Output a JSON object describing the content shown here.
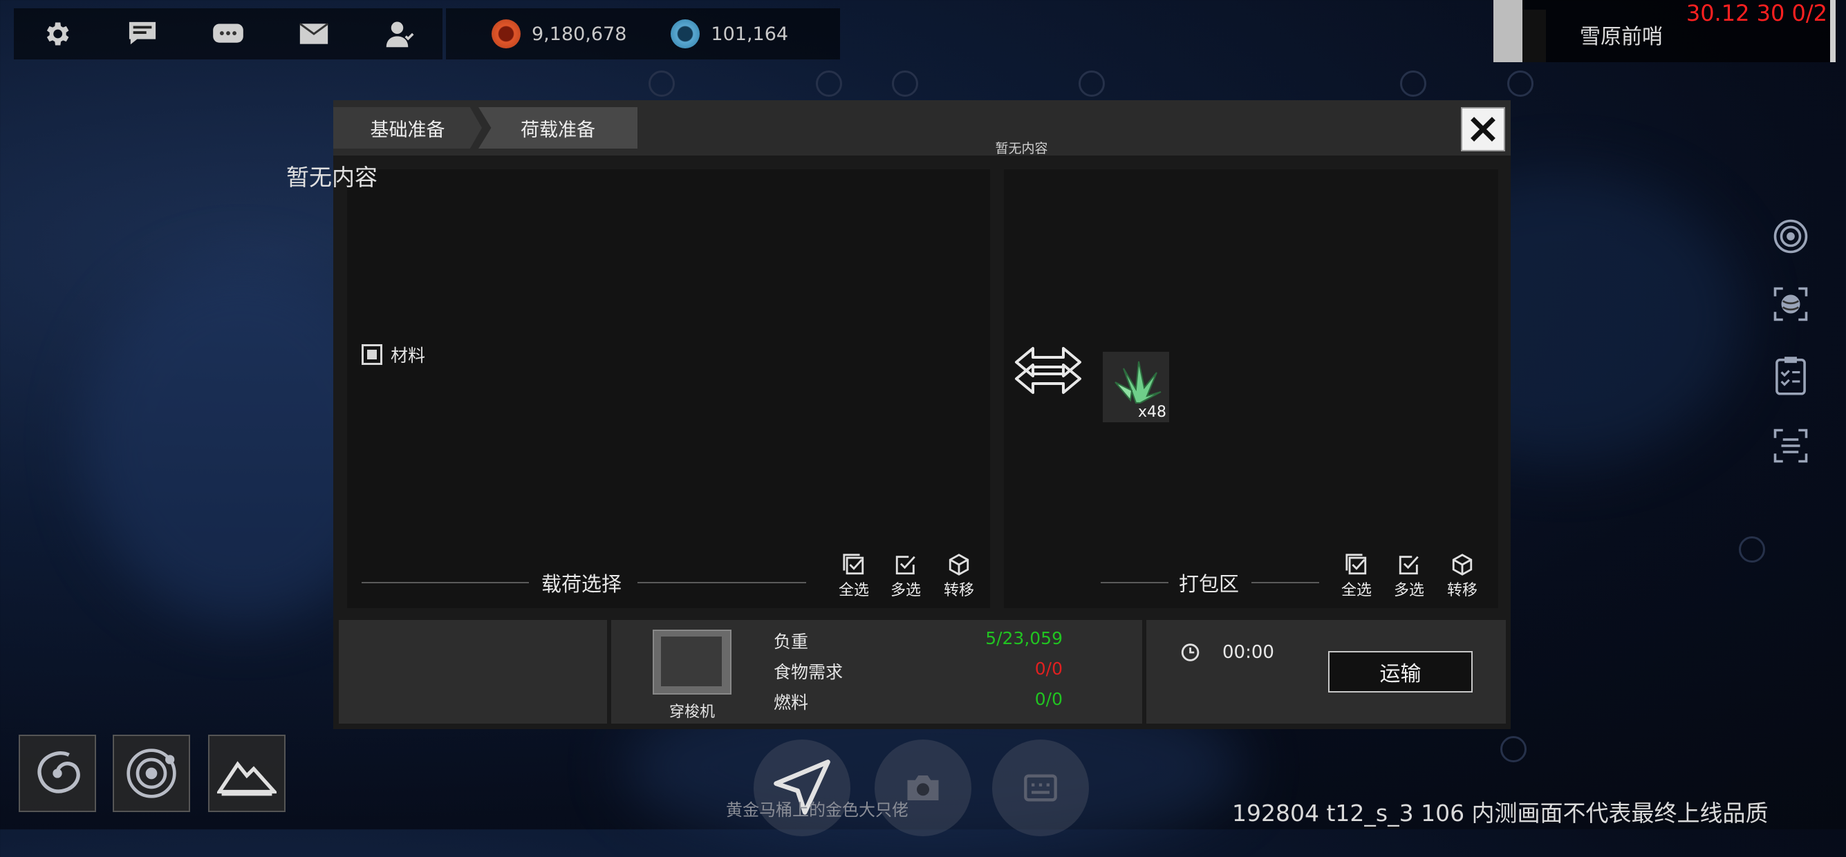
{
  "top_bar": {
    "icons": [
      "gear-icon",
      "chat-icon",
      "message-bubbles-icon",
      "mail-icon",
      "friends-icon"
    ],
    "resource1_value": "9,180,678",
    "resource2_value": "101,164"
  },
  "location": {
    "name": "雪原前哨",
    "debug_readout": "30.12 30 0/2"
  },
  "dialog": {
    "tabs": [
      "基础准备",
      "荷载准备"
    ],
    "left_empty_text": "暂无内容",
    "right_empty_text": "暂无内容",
    "category_label": "材料",
    "item_quantity": "x48",
    "left_section_title": "载荷选择",
    "right_section_title": "打包区",
    "left_actions": [
      "全选",
      "多选",
      "转移"
    ],
    "right_actions": [
      "全选",
      "多选",
      "转移"
    ],
    "ship_name": "穿梭机",
    "stats": [
      {
        "label": "负重",
        "value": "5/23,059",
        "color": "#21c321"
      },
      {
        "label": "食物需求",
        "value": "0/0",
        "color": "#e02020"
      },
      {
        "label": "燃料",
        "value": "0/0",
        "color": "#21c321"
      }
    ],
    "timer": "00:00",
    "transport_label": "运输"
  },
  "bottom": {
    "player_name": "黄金马桶上的金色大只佬",
    "footer_text": "192804 t12_s_3 106  内测画面不代表最终上线品质"
  }
}
